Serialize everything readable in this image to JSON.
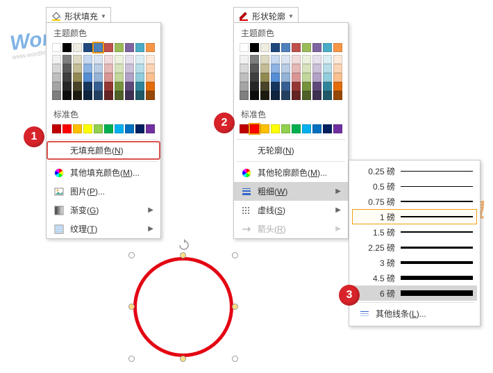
{
  "fill_dropdown": {
    "label": "形状填充"
  },
  "outline_dropdown": {
    "label": "形状轮廓"
  },
  "labels": {
    "theme_colors": "主题颜色",
    "standard_colors": "标准色"
  },
  "theme_colors": [
    [
      "#ffffff",
      "#000000",
      "#eeece1",
      "#1f497d",
      "#4f81bd",
      "#c0504d",
      "#9bbb59",
      "#8064a2",
      "#4bacc6",
      "#f79646"
    ],
    [
      "#f2f2f2",
      "#7f7f7f",
      "#ddd9c3",
      "#c6d9f0",
      "#dbe5f1",
      "#f2dcdb",
      "#ebf1dd",
      "#e5e0ec",
      "#dbeef3",
      "#fdeada"
    ],
    [
      "#d8d8d8",
      "#595959",
      "#c4bd97",
      "#8db3e2",
      "#b8cce4",
      "#e5b9b7",
      "#d7e3bc",
      "#ccc1d9",
      "#b7dde8",
      "#fbd5b5"
    ],
    [
      "#bfbfbf",
      "#3f3f3f",
      "#938953",
      "#548dd4",
      "#95b3d7",
      "#d99694",
      "#c3d69b",
      "#b2a2c7",
      "#92cddc",
      "#fac08f"
    ],
    [
      "#a5a5a5",
      "#262626",
      "#494429",
      "#17365d",
      "#366092",
      "#953734",
      "#76923c",
      "#5f497a",
      "#31859b",
      "#e36c09"
    ],
    [
      "#7f7f7f",
      "#0c0c0c",
      "#1d1b10",
      "#0f243e",
      "#244061",
      "#632423",
      "#4f6128",
      "#3f3151",
      "#205867",
      "#974806"
    ]
  ],
  "standard_colors": [
    "#c00000",
    "#ff0000",
    "#ffc000",
    "#ffff00",
    "#92d050",
    "#00b050",
    "#00b0f0",
    "#0070c0",
    "#002060",
    "#7030a0"
  ],
  "fill_menu": {
    "no_fill": "无填充颜色(N)",
    "more_colors": "其他填充颜色(M)...",
    "picture": "图片(P)...",
    "gradient": "渐变(G)",
    "texture": "纹理(T)"
  },
  "outline_menu": {
    "no_outline": "无轮廓(N)",
    "more_colors": "其他轮廓颜色(M)...",
    "weight": "粗细(W)",
    "dashes": "虚线(S)",
    "arrows": "箭头(R)"
  },
  "weight_options": [
    {
      "label": "0.25 磅",
      "px": 0.5
    },
    {
      "label": "0.5 磅",
      "px": 1
    },
    {
      "label": "0.75 磅",
      "px": 1.2
    },
    {
      "label": "1 磅",
      "px": 1.5
    },
    {
      "label": "1.5 磅",
      "px": 2
    },
    {
      "label": "2.25 磅",
      "px": 3
    },
    {
      "label": "3 磅",
      "px": 4
    },
    {
      "label": "4.5 磅",
      "px": 6
    },
    {
      "label": "6 磅",
      "px": 8
    }
  ],
  "weight_more": "其他线条(L)...",
  "badges": {
    "one": "1",
    "two": "2",
    "three": "3"
  },
  "watermark": {
    "brand": "Word",
    "suffix": "联盟",
    "url": "www.wordlm.com"
  }
}
